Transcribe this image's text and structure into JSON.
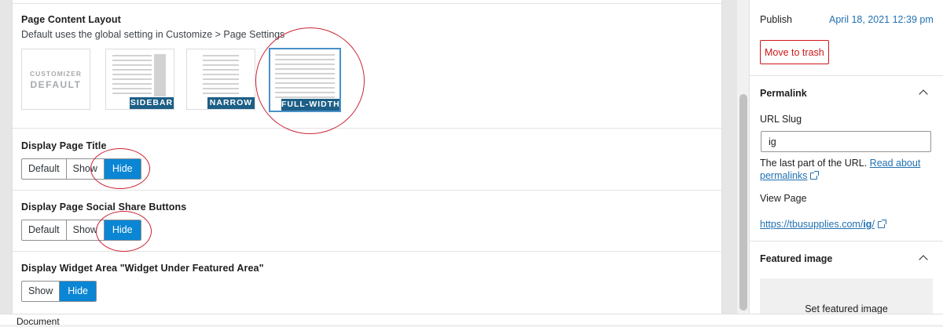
{
  "layout_section": {
    "title": "Page Content Layout",
    "description": "Default uses the global setting in Customize > Page Settings",
    "options": [
      {
        "line1": "CUSTOMIZER",
        "line2": "DEFAULT"
      },
      {
        "label": "SIDEBAR"
      },
      {
        "label": "NARROW"
      },
      {
        "label": "FULL-WIDTH",
        "selected": true
      }
    ]
  },
  "title_section": {
    "title": "Display Page Title",
    "buttons": [
      "Default",
      "Show",
      "Hide"
    ],
    "active": "Hide"
  },
  "social_section": {
    "title": "Display Page Social Share Buttons",
    "buttons": [
      "Default",
      "Show",
      "Hide"
    ],
    "active": "Hide"
  },
  "widget_section": {
    "title": "Display Widget Area \"Widget Under Featured Area\"",
    "buttons": [
      "Show",
      "Hide"
    ],
    "active": "Hide"
  },
  "sidebar": {
    "publish_label": "Publish",
    "publish_date": "April 18, 2021 12:39 pm",
    "trash_label": "Move to trash",
    "permalink": {
      "title": "Permalink",
      "slug_label": "URL Slug",
      "slug_value": "ig",
      "help_text": "The last part of the URL.",
      "help_link_1": "Read about",
      "help_link_2": "permalinks",
      "view_label": "View Page",
      "url_prefix": "https://tbusupplies.com/",
      "url_slug": "ig",
      "url_suffix": "/"
    },
    "featured": {
      "title": "Featured image",
      "set_label": "Set featured image"
    }
  },
  "footer": {
    "breadcrumb": "Document"
  },
  "colors": {
    "accent": "#0a86d4",
    "annotation": "#cc2433",
    "danger": "#cc1818",
    "link": "#2271b1",
    "tag": "#1d5f86"
  }
}
